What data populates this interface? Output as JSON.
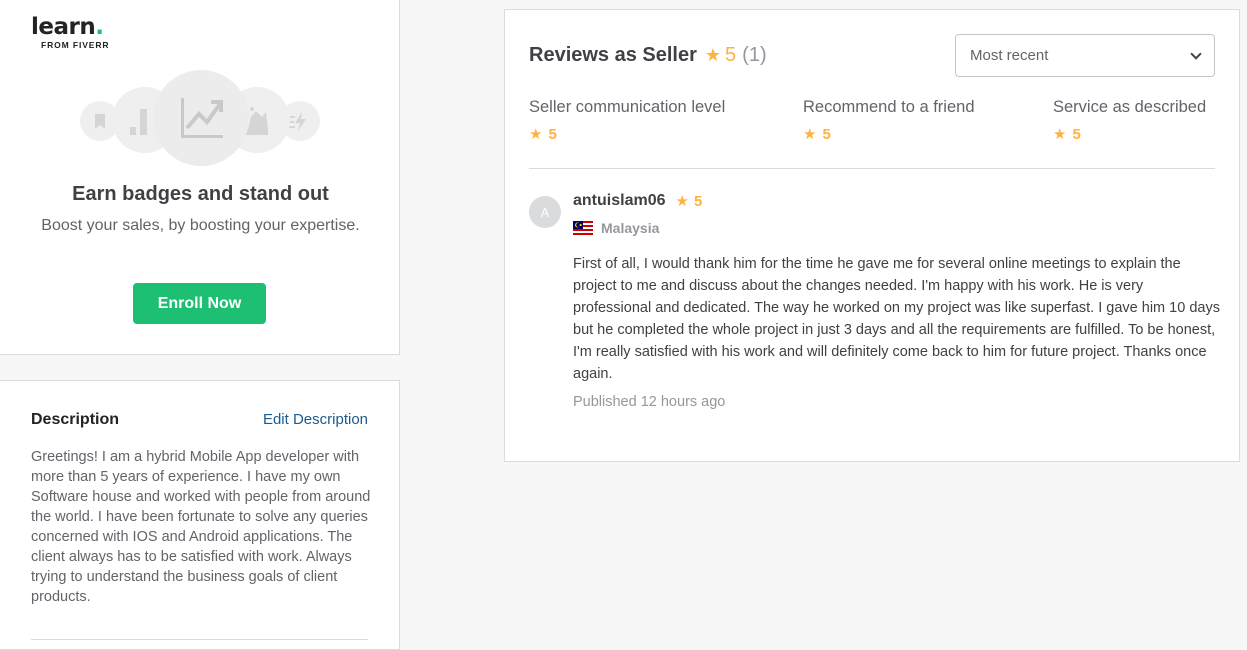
{
  "learn": {
    "logo_main": "learn",
    "logo_dot": ".",
    "logo_sub": "FROM FIVERR",
    "title": "Earn badges and stand out",
    "subtitle": "Boost your sales, by boosting your expertise.",
    "enroll_label": "Enroll Now",
    "accent_color": "#1dbf73"
  },
  "description": {
    "title": "Description",
    "edit_label": "Edit Description",
    "body": "Greetings! I am a hybrid Mobile App developer with more than 5 years of experience. I have my own Software house and worked with people from around the world. I have been fortunate to solve any queries concerned with IOS and Android applications. The client always has to be satisfied with work. Always trying to understand the business goals of client products."
  },
  "reviews": {
    "heading": "Reviews as Seller",
    "score": "5",
    "count": "(1)",
    "sort": {
      "selected": "Most recent"
    },
    "metrics": [
      {
        "label": "Seller communication level",
        "score": "5"
      },
      {
        "label": "Recommend to a friend",
        "score": "5"
      },
      {
        "label": "Service as described",
        "score": "5"
      }
    ],
    "items": [
      {
        "avatar_letter": "A",
        "name": "antuislam06",
        "score": "5",
        "country": "Malaysia",
        "text": "First of all, I would thank him for the time he gave me for several online meetings to explain the project to me and discuss about the changes needed. I'm happy with his work. He is very professional and dedicated. The way he worked on my project was like superfast. I gave him 10 days but he completed the whole project in just 3 days and all the requirements are fulfilled. To be honest, I'm really satisfied with his work and will definitely come back to him for future project. Thanks once again.",
        "published": "Published 12 hours ago"
      }
    ],
    "star_color": "#ffb33e"
  }
}
